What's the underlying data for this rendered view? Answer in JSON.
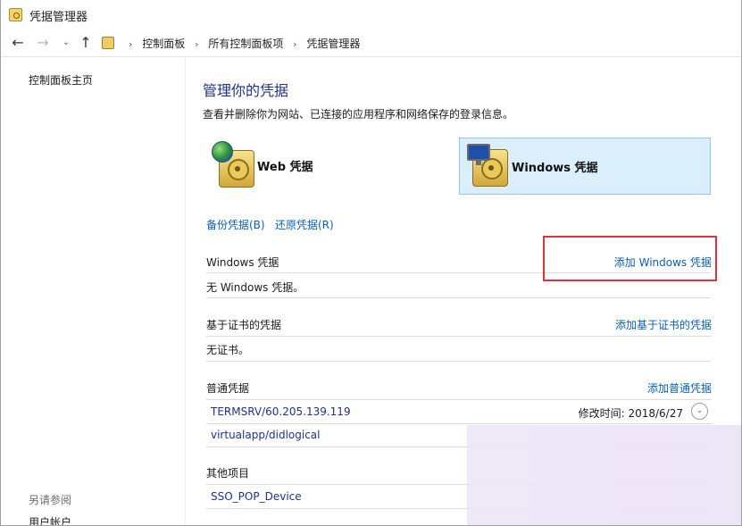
{
  "window": {
    "title": "凭据管理器"
  },
  "nav": {
    "back_icon": "back-arrow-icon",
    "forward_icon": "forward-arrow-icon",
    "up_icon": "up-arrow-icon",
    "breadcrumbs": [
      "控制面板",
      "所有控制面板项",
      "凭据管理器"
    ]
  },
  "left": {
    "home_link": "控制面板主页",
    "see_also": "另请参阅",
    "user_accounts": "用户帐户"
  },
  "main": {
    "heading": "管理你的凭据",
    "subtitle": "查看并删除你为网站、已连接的应用程序和网络保存的登录信息。",
    "tiles": [
      {
        "label": "Web 凭据",
        "selected": false
      },
      {
        "label": "Windows 凭据",
        "selected": true
      }
    ],
    "backup_link": "备份凭据(B)",
    "restore_link": "还原凭据(R)",
    "windows_section": {
      "title": "Windows 凭据",
      "add_link": "添加 Windows 凭据",
      "empty_text": "无 Windows 凭据。"
    },
    "cert_section": {
      "title": "基于证书的凭据",
      "add_link": "添加基于证书的凭据",
      "empty_text": "无证书。"
    },
    "generic_section": {
      "title": "普通凭据",
      "add_link": "添加普通凭据",
      "items": [
        {
          "name": "TERMSRV/60.205.139.119",
          "modified": "修改时间:  2018/6/27"
        },
        {
          "name": "virtualapp/didlogical",
          "modified": ""
        }
      ]
    },
    "other_section": {
      "title": "其他项目",
      "items": [
        {
          "name": "SSO_POP_Device"
        }
      ]
    }
  },
  "colors": {
    "link": "#0a5fb4",
    "heading": "#1e3287",
    "selected_tile_bg": "#dbeefb",
    "highlight_box": "#e5303a"
  }
}
